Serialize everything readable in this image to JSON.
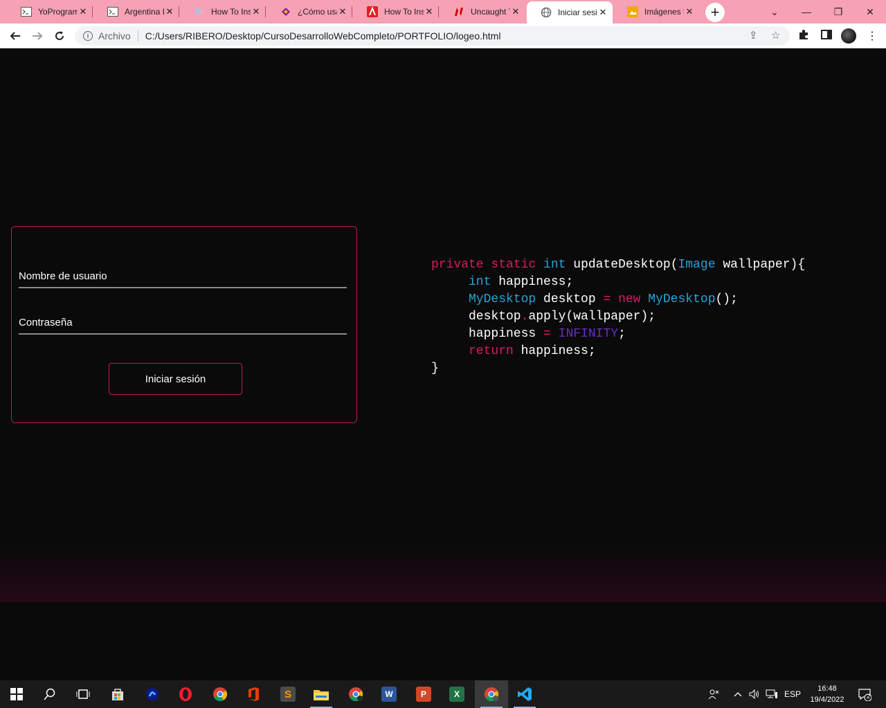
{
  "browser": {
    "tabs": [
      {
        "title": "YoProgramo",
        "icon": "terminal-icon",
        "active": false
      },
      {
        "title": "Argentina Programa",
        "icon": "terminal-icon",
        "active": false
      },
      {
        "title": "How To Install",
        "icon": "hands-icon",
        "active": false
      },
      {
        "title": "¿Cómo usar",
        "icon": "diamond-icon",
        "active": false
      },
      {
        "title": "How To Install",
        "icon": "acrobat-icon",
        "active": false
      },
      {
        "title": "Uncaught TypeError",
        "icon": "n-logo-icon",
        "active": false
      },
      {
        "title": "Iniciar sesión",
        "icon": "globe-icon",
        "active": true
      },
      {
        "title": "Imágenes libres",
        "icon": "image-icon",
        "active": false
      }
    ],
    "new_tab_symbol": "+",
    "address": {
      "chip": "Archivo",
      "url": "C:/Users/RIBERO/Desktop/CursoDesarrolloWebCompleto/PORTFOLIO/logeo.html"
    }
  },
  "login": {
    "username_label": "Nombre de usuario",
    "password_label": "Contraseña",
    "button_label": "Iniciar sesión"
  },
  "code_lines": [
    [
      {
        "t": "private ",
        "c": "kw"
      },
      {
        "t": "static ",
        "c": "kw"
      },
      {
        "t": "int ",
        "c": "ty"
      },
      {
        "t": "updateDesktop(",
        "c": "pl"
      },
      {
        "t": "Image ",
        "c": "ty"
      },
      {
        "t": "wallpaper){",
        "c": "pl"
      }
    ],
    [
      {
        "t": "int ",
        "c": "ty"
      },
      {
        "t": "happiness;",
        "c": "pl"
      }
    ],
    [
      {
        "t": "MyDesktop ",
        "c": "ty"
      },
      {
        "t": "desktop ",
        "c": "pl"
      },
      {
        "t": "= ",
        "c": "kw"
      },
      {
        "t": "new ",
        "c": "kw"
      },
      {
        "t": "MyDesktop",
        "c": "ty"
      },
      {
        "t": "();",
        "c": "pl"
      }
    ],
    [
      {
        "t": "desktop",
        "c": "pl"
      },
      {
        "t": ".",
        "c": "kw"
      },
      {
        "t": "apply(wallpaper);",
        "c": "pl"
      }
    ],
    [
      {
        "t": "happiness ",
        "c": "pl"
      },
      {
        "t": "= ",
        "c": "kw"
      },
      {
        "t": "INFINITY",
        "c": "cs"
      },
      {
        "t": ";",
        "c": "pl"
      }
    ],
    [
      {
        "t": "return ",
        "c": "kw"
      },
      {
        "t": "happiness;",
        "c": "pl"
      }
    ],
    [
      {
        "t": "}",
        "c": "pl"
      }
    ]
  ],
  "colors": {
    "accent": "#c2185b",
    "keyword": "#d81b60",
    "type": "#29a3d6",
    "constant": "#6b2cc9",
    "tab_strip": "#f7a1b4"
  },
  "taskbar": {
    "apps": [
      "windows-start-icon",
      "search-icon",
      "task-view-icon",
      "store-icon",
      "edge-legacy-icon",
      "opera-icon",
      "chrome-icon",
      "office-icon",
      "sublime-icon",
      "file-explorer-icon",
      "chrome-canary-icon",
      "word-icon",
      "powerpoint-icon",
      "excel-icon",
      "chrome-active-icon",
      "vscode-icon"
    ],
    "language": "ESP",
    "time": "16:48",
    "date": "19/4/2022",
    "notifications": "2"
  }
}
